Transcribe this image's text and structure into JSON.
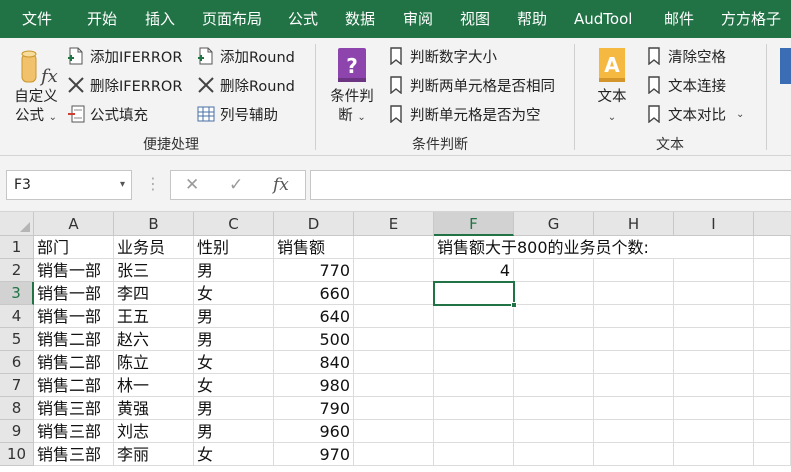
{
  "ribbon_tabs": [
    "文件",
    "开始",
    "插入",
    "页面布局",
    "公式",
    "数据",
    "审阅",
    "视图",
    "帮助",
    "AudTool",
    "邮件",
    "方方格子"
  ],
  "groups": {
    "convenience": {
      "label": "便捷处理",
      "custom_formula": [
        "自定义",
        "公式"
      ],
      "add_iferror": "添加IFERROR",
      "del_iferror": "删除IFERROR",
      "formula_fill": "公式填充",
      "add_round": "添加Round",
      "del_round": "删除Round",
      "column_helper": "列号辅助"
    },
    "condition": {
      "label": "条件判断",
      "cond_judge": [
        "条件判",
        "断"
      ],
      "judge_number": "判断数字大小",
      "judge_two_cells": "判断两单元格是否相同",
      "judge_empty": "判断单元格是否为空"
    },
    "text": {
      "label": "文本",
      "text_btn": "文本",
      "clear_spaces": "清除空格",
      "text_concat": "文本连接",
      "text_compare": "文本对比"
    }
  },
  "formula_bar": {
    "name_box": "F3",
    "formula": ""
  },
  "sheet": {
    "columns": [
      "A",
      "B",
      "C",
      "D",
      "E",
      "F",
      "G",
      "H",
      "I"
    ],
    "rows": [
      "1",
      "2",
      "3",
      "4",
      "5",
      "6",
      "7",
      "8",
      "9",
      "10"
    ],
    "header": [
      "部门",
      "业务员",
      "性别",
      "销售额"
    ],
    "data": [
      [
        "销售一部",
        "张三",
        "男",
        "770"
      ],
      [
        "销售一部",
        "李四",
        "女",
        "660"
      ],
      [
        "销售一部",
        "王五",
        "男",
        "640"
      ],
      [
        "销售二部",
        "赵六",
        "男",
        "500"
      ],
      [
        "销售二部",
        "陈立",
        "女",
        "840"
      ],
      [
        "销售二部",
        "林一",
        "女",
        "980"
      ],
      [
        "销售三部",
        "黄强",
        "男",
        "790"
      ],
      [
        "销售三部",
        "刘志",
        "男",
        "960"
      ],
      [
        "销售三部",
        "李丽",
        "女",
        "970"
      ]
    ],
    "f1_label": "销售额大于800的业务员个数:",
    "f2_value": "4"
  }
}
